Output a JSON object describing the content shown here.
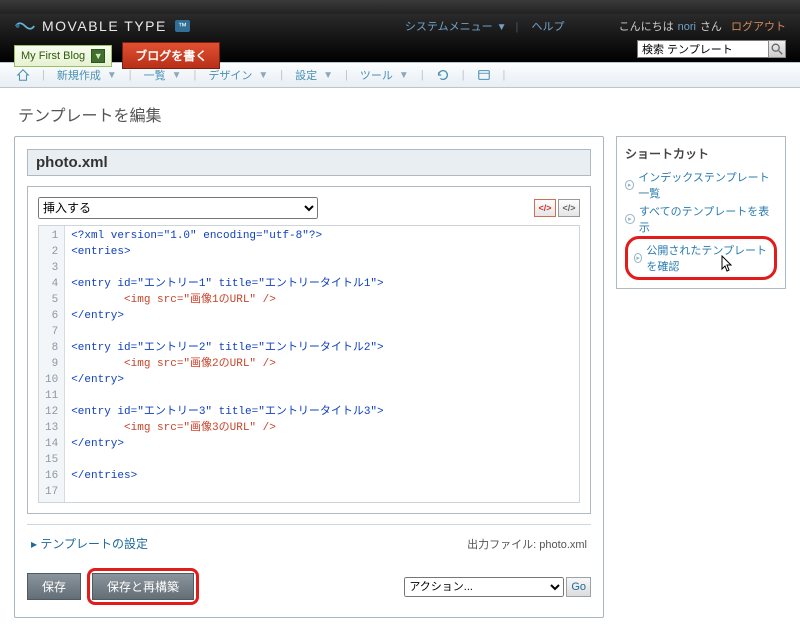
{
  "app": {
    "name": "MOVABLE TYPE",
    "badge": "™"
  },
  "top_links": {
    "system_menu": "システムメニュー",
    "help": "ヘルプ",
    "hello_prefix": "こんにちは",
    "user": "nori",
    "hello_suffix": "さん",
    "logout": "ログアウト"
  },
  "search": {
    "value": "検索 テンプレート"
  },
  "blog_selector": {
    "name": "My First Blog"
  },
  "write_blog": "ブログを書く",
  "menu": {
    "new": "新規作成",
    "list": "一覧",
    "design": "デザイン",
    "settings": "設定",
    "tools": "ツール"
  },
  "page_title": "テンプレートを編集",
  "template_name": "photo.xml",
  "insert_placeholder": "挿入する",
  "code_lines": [
    "<?xml version=\"1.0\" encoding=\"utf-8\"?>",
    "<entries>",
    "",
    "<entry id=\"エントリー1\" title=\"エントリータイトル1\">",
    "        <img src=\"画像1のURL\" />",
    "</entry>",
    "",
    "<entry id=\"エントリー2\" title=\"エントリータイトル2\">",
    "        <img src=\"画像2のURL\" />",
    "</entry>",
    "",
    "<entry id=\"エントリー3\" title=\"エントリータイトル3\">",
    "        <img src=\"画像3のURL\" />",
    "</entry>",
    "",
    "</entries>",
    ""
  ],
  "settings_link": "テンプレートの設定",
  "output_file_label": "出力ファイル:",
  "output_file_value": "photo.xml",
  "buttons": {
    "save": "保存",
    "save_rebuild": "保存と再構築"
  },
  "action_select": "アクション...",
  "go": "Go",
  "sidebar": {
    "title": "ショートカット",
    "links": [
      "インデックステンプレート一覧",
      "すべてのテンプレートを表示",
      "公開されたテンプレートを確認"
    ]
  }
}
